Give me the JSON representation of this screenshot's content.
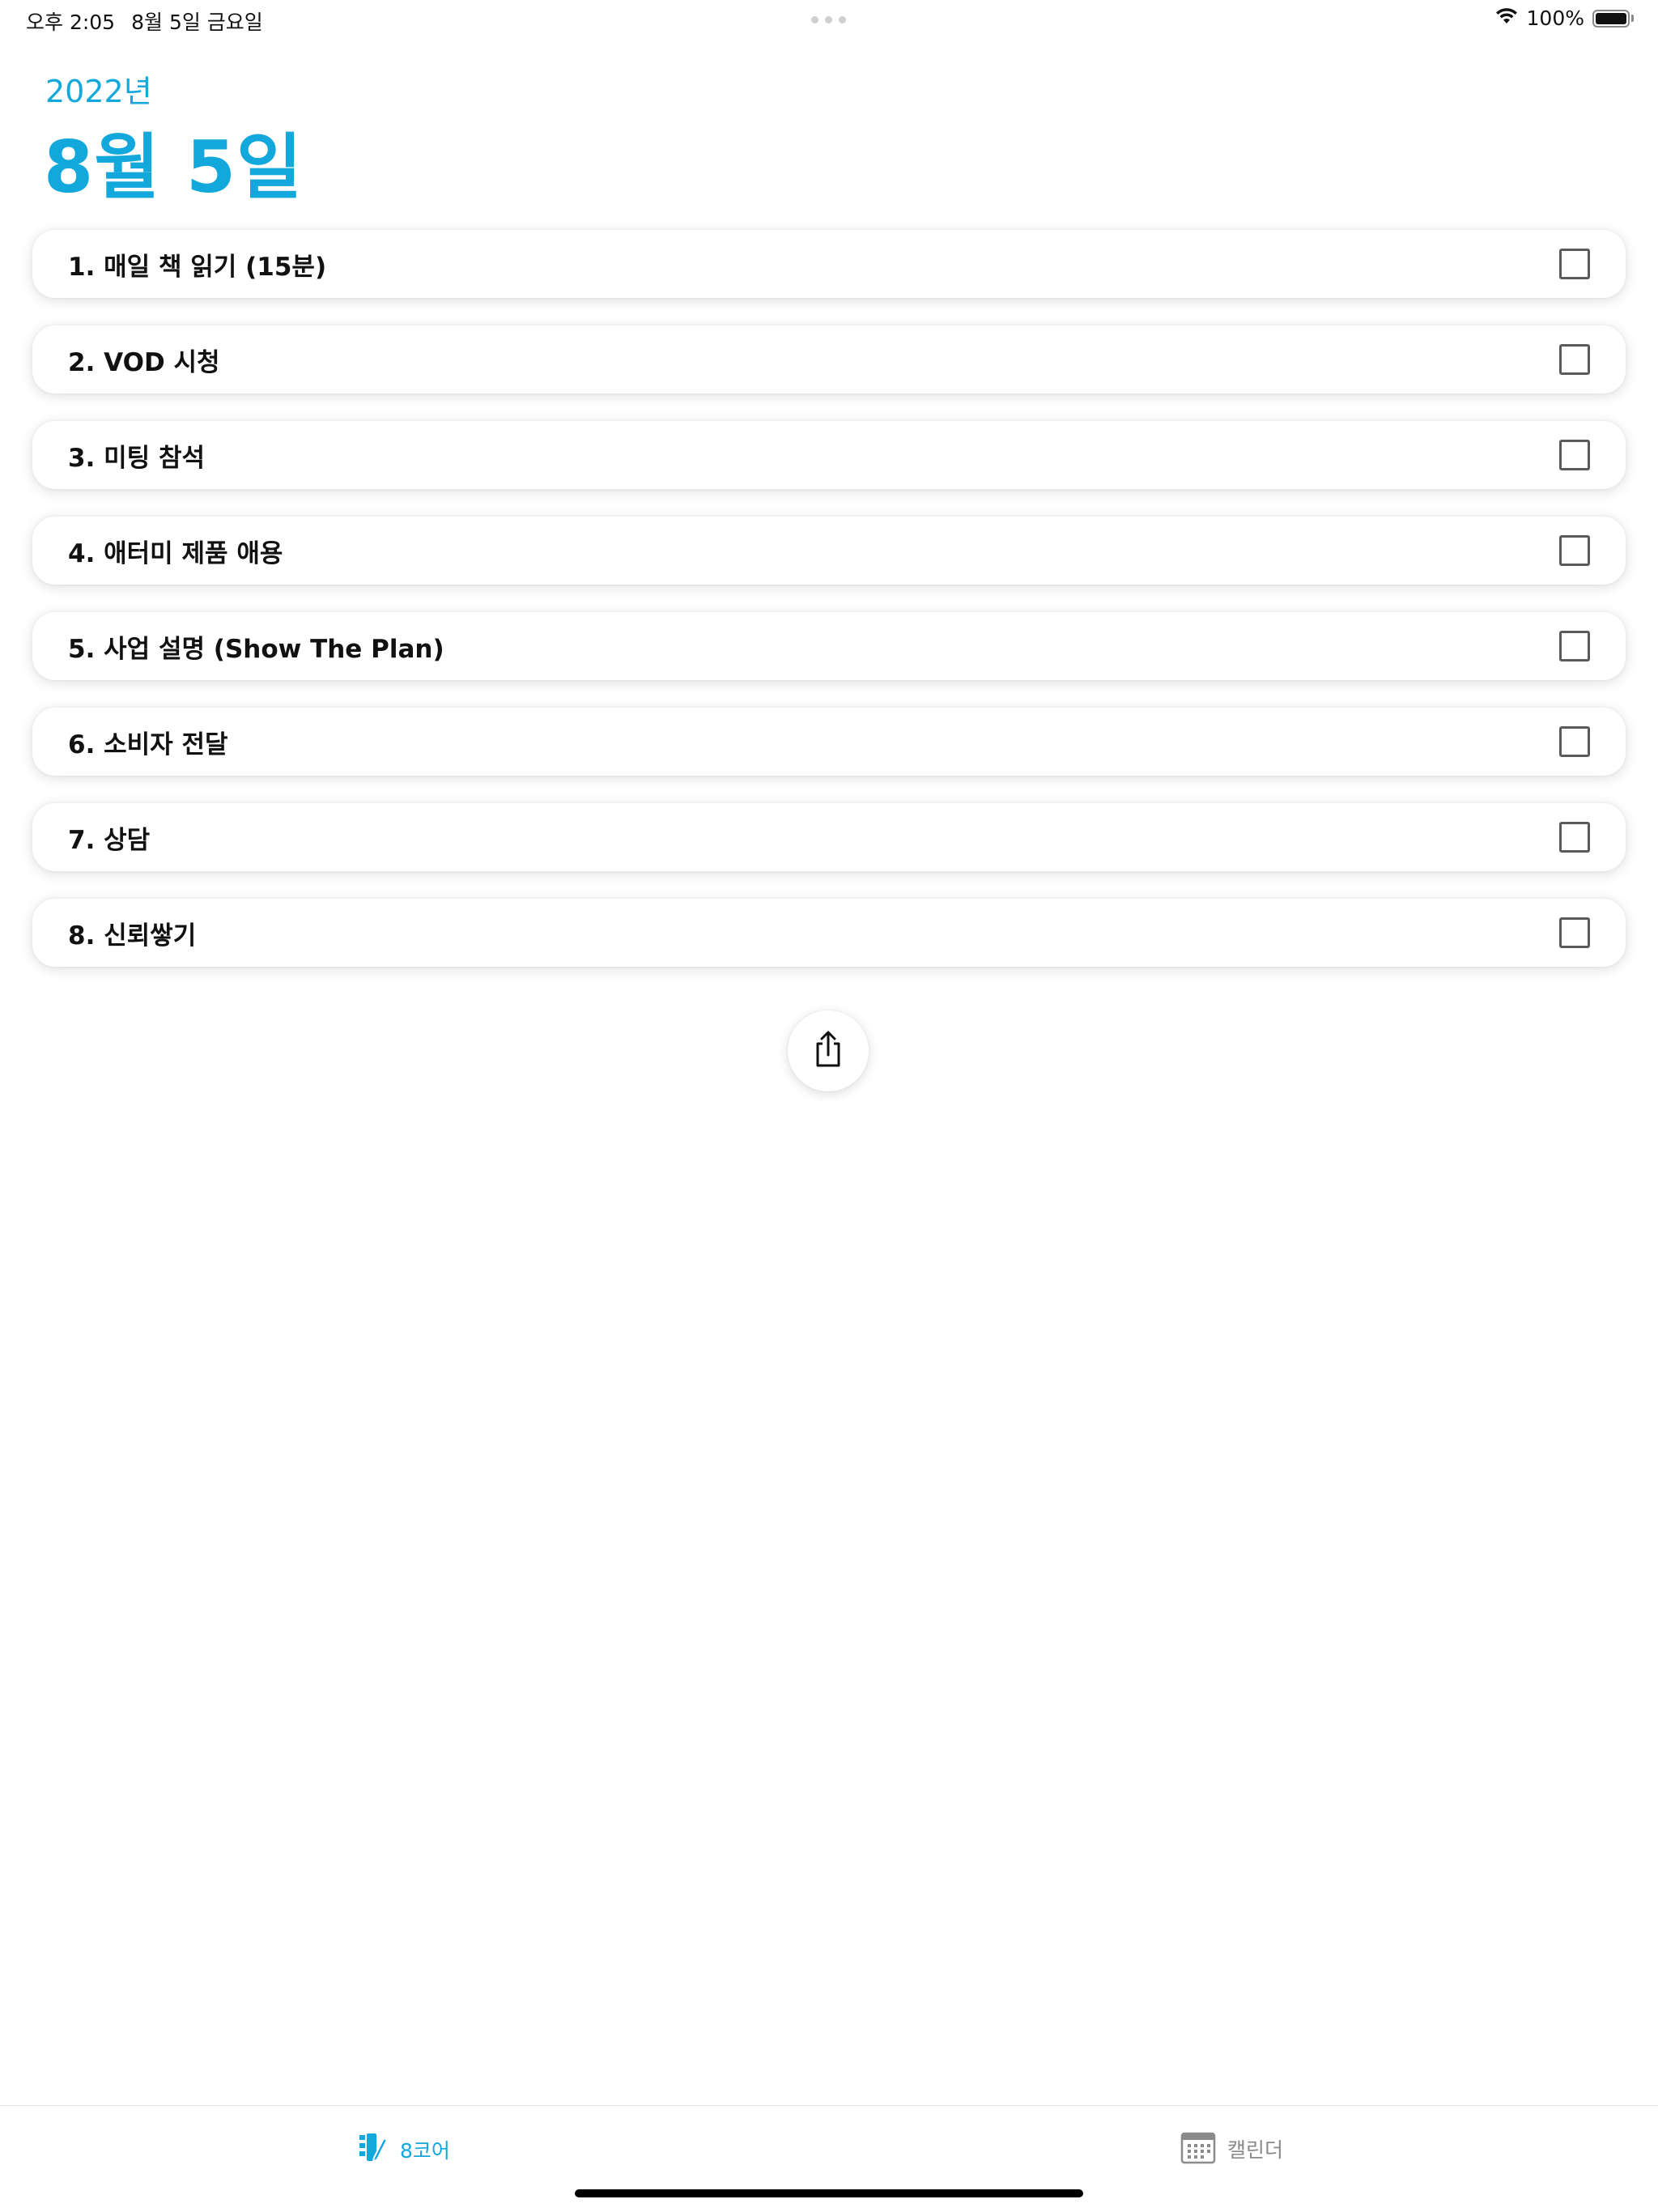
{
  "status_bar": {
    "time": "오후 2:05",
    "date": "8월 5일 금요일",
    "battery_text": "100%",
    "wifi_icon": "wifi-icon",
    "battery_icon": "battery-full-icon"
  },
  "header": {
    "year": "2022년",
    "date": "8월 5일"
  },
  "tasks": [
    {
      "label": "1. 매일 책 읽기 (15분)",
      "checked": false
    },
    {
      "label": "2. VOD 시청",
      "checked": false
    },
    {
      "label": "3. 미팅 참석",
      "checked": false
    },
    {
      "label": "4. 애터미 제품 애용",
      "checked": false
    },
    {
      "label": "5. 사업 설명 (Show The Plan)",
      "checked": false
    },
    {
      "label": "6. 소비자 전달",
      "checked": false
    },
    {
      "label": "7. 상담",
      "checked": false
    },
    {
      "label": "8. 신뢰쌓기",
      "checked": false
    }
  ],
  "share": {
    "icon": "share-icon"
  },
  "tab_bar": {
    "tabs": [
      {
        "label": "8코어",
        "icon": "checklist-pencil-icon",
        "active": true
      },
      {
        "label": "캘린더",
        "icon": "calendar-icon",
        "active": false
      }
    ]
  },
  "colors": {
    "accent": "#12a8dc",
    "inactive_tab": "#8a8a8a",
    "checkbox_border": "#5a5a5a"
  }
}
